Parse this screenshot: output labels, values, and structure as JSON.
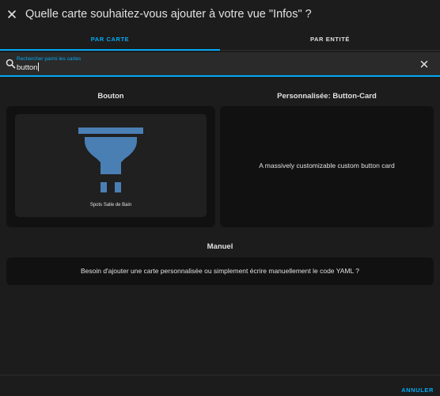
{
  "dialog": {
    "title": "Quelle carte souhaitez-vous ajouter à votre vue \"Infos\" ?"
  },
  "tabs": [
    {
      "label": "PAR CARTE",
      "active": true
    },
    {
      "label": "PAR ENTITÉ",
      "active": false
    }
  ],
  "search": {
    "label": "Rechercher parmi les cartes",
    "value": "button"
  },
  "sections": {
    "bouton": {
      "title": "Bouton",
      "preview_name": "Spots Salle de Bain",
      "icon": "ceiling-light-icon"
    },
    "custom": {
      "title": "Personnalisée: Button-Card",
      "description": "A massively customizable custom button card"
    },
    "manuel": {
      "title": "Manuel",
      "description": "Besoin d'ajouter une carte personnalisée ou simplement écrire manuellement le code YAML ?"
    }
  },
  "footer": {
    "cancel_label": "ANNULER"
  },
  "colors": {
    "accent": "#03a9f4",
    "icon": "#4a7fb3",
    "background": "#1c1c1c",
    "card": "#111111"
  }
}
